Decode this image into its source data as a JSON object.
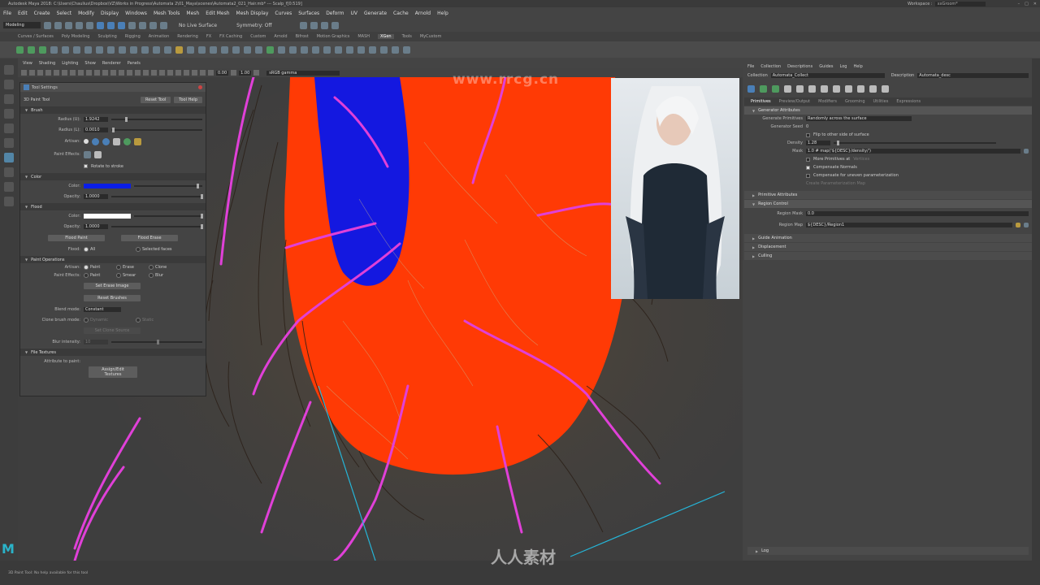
{
  "title": {
    "text": "Autodesk Maya 2018: C:\\Users\\Chaulius\\Dropbox\\VZ\\Works in Progress\\Automata 2\\01_Maya\\scenes\\Automata2_021_Hair.mb* --- Scalp_f[0:519]",
    "workspace_label": "Workspace :",
    "workspace_value": "xxGroom*",
    "controls": [
      "–",
      "□",
      "✕"
    ]
  },
  "watermark": {
    "top": "www.rrcg.cn",
    "bottom": "人人素材"
  },
  "menus": [
    "File",
    "Edit",
    "Create",
    "Select",
    "Modify",
    "Display",
    "Windows",
    "Mesh Tools",
    "Mesh",
    "Edit Mesh",
    "Mesh Display",
    "Curves",
    "Surfaces",
    "Deform",
    "UV",
    "Generate",
    "Cache",
    "Arnold",
    "Help"
  ],
  "status": {
    "mode": "Modeling",
    "live_surface": "No Live Surface",
    "symmetry": "Symmetry: Off"
  },
  "shelf_tabs": [
    "Curves / Surfaces",
    "Poly Modeling",
    "Sculpting",
    "Rigging",
    "Animation",
    "Rendering",
    "FX",
    "FX Caching",
    "Custom",
    "Arnold",
    "Bifrost",
    "Motion Graphics",
    "MASH",
    "XGen",
    "Tools",
    "MyCustom"
  ],
  "shelf_active": "XGen",
  "viewport": {
    "menu": [
      "View",
      "Shading",
      "Lighting",
      "Show",
      "Renderer",
      "Panels"
    ],
    "field1": "0.00",
    "field2": "1.00",
    "colorspace": "sRGB gamma"
  },
  "tool_settings": {
    "window_title": "Tool Settings",
    "tool_name": "3D Paint Tool",
    "reset_tool": "Reset Tool",
    "tool_help": "Tool Help",
    "brush": {
      "section": "Brush",
      "radius_u_label": "Radius (U):",
      "radius_u": "1.9242",
      "radius_l_label": "Radius (L):",
      "radius_l": "0.0010",
      "artisan_label": "Artisan:",
      "paint_effects_label": "Paint Effects:",
      "rotate_to_stroke": "Rotate to stroke"
    },
    "color": {
      "section": "Color",
      "color_label": "Color:",
      "color_value": "#0a1ee6",
      "opacity_label": "Opacity:",
      "opacity": "1.0000"
    },
    "flood": {
      "section": "Flood",
      "color_label": "Color:",
      "color_value": "#ffffff",
      "opacity_label": "Opacity:",
      "opacity": "1.0000",
      "flood_paint": "Flood Paint",
      "flood_erase": "Flood Erase",
      "flood_label": "Flood:",
      "flood_all": "All",
      "flood_selected": "Selected faces"
    },
    "paint_operations": {
      "section": "Paint Operations",
      "artisan_label": "Artisan:",
      "paint_effects_label": "Paint Effects:",
      "artisan_opts": [
        "Paint",
        "Erase",
        "Clone"
      ],
      "pe_opts": [
        "Paint",
        "Smear",
        "Blur"
      ],
      "set_erase_image": "Set Erase Image",
      "reset_brushes": "Reset Brushes",
      "blend_mode_label": "Blend mode:",
      "blend_mode": "Constant",
      "clone_brush_mode_label": "Clone brush mode:",
      "clone_opts": [
        "Dynamic",
        "Static"
      ],
      "set_clone_source": "Set Clone Source",
      "blur_intensity_label": "Blur intensity:",
      "blur_intensity": "10"
    },
    "file_textures": {
      "section": "File Textures",
      "attribute_label": "Attribute to paint:",
      "cut_button": "Assign/Edit Textures"
    }
  },
  "xgen": {
    "menu": [
      "File",
      "Collection",
      "Descriptions",
      "Guides",
      "Log",
      "Help"
    ],
    "collection_label": "Collection",
    "collection": "Automata_Collect",
    "description_label": "Description",
    "description": "Automata_desc",
    "tabs": [
      "Primitives",
      "Preview/Output",
      "Modifiers",
      "Grooming",
      "Utilities",
      "Expressions"
    ],
    "active_tab": "Primitives",
    "generator_section": "Generator Attributes",
    "generate_primitives_label": "Generate Primitives",
    "generate_primitives": "Randomly across the surface",
    "generator_seed_label": "Generator Seed",
    "generator_seed": "0",
    "flip_label": "Flip to other side of surface",
    "density_label": "Density",
    "density": "1.28",
    "mask_label": "Mask",
    "mask": "1.0 # map('${DESC}/density/')",
    "more_primitives_label": "More Primitives at",
    "more_primitives_value": "Vertices",
    "compensate_normals": "Compensate Normals",
    "compensate_uneven": "Compensate for uneven parameterization",
    "create_param_map": "Create Parameterization Map",
    "primitive_section": "Primitive Attributes",
    "region_section": "Region Control",
    "region_mask_label": "Region Mask",
    "region_mask": "0.0",
    "region_map_label": "Region Map",
    "region_map": "${DESC}/Region1",
    "guide_section": "Guide Animation",
    "displacement_section": "Displacement",
    "culling_section": "Culling",
    "log_section": "Log"
  },
  "help_line": "3D Paint Tool: No help available for this tool",
  "colors": {
    "accent": "#5285a6",
    "paint_red": "#ff3a05",
    "paint_blue": "#1418e0",
    "guide_magenta": "#e040d8",
    "axis_cyan": "#25b5d8"
  }
}
